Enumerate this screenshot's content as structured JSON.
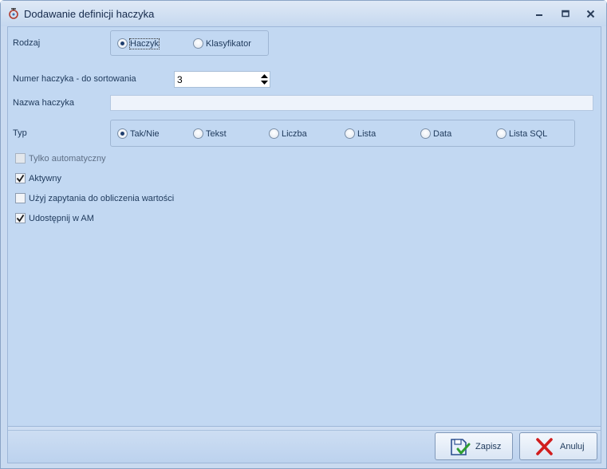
{
  "window": {
    "title": "Dodawanie definicji haczyka",
    "icon": "hook-definition-icon",
    "controls": [
      "minimize-icon",
      "maximize-icon",
      "close-icon"
    ]
  },
  "form": {
    "rodzaj": {
      "label": "Rodzaj",
      "options": [
        {
          "label": "Haczyk",
          "selected": true
        },
        {
          "label": "Klasyfikator",
          "selected": false
        }
      ]
    },
    "numer": {
      "label": "Numer haczyka - do sortowania",
      "value": "3"
    },
    "nazwa": {
      "label": "Nazwa haczyka",
      "value": ""
    },
    "typ": {
      "label": "Typ",
      "options": [
        {
          "label": "Tak/Nie",
          "selected": true
        },
        {
          "label": "Tekst",
          "selected": false
        },
        {
          "label": "Liczba",
          "selected": false
        },
        {
          "label": "Lista",
          "selected": false
        },
        {
          "label": "Data",
          "selected": false
        },
        {
          "label": "Lista SQL",
          "selected": false
        }
      ]
    },
    "checkboxes": [
      {
        "label": "Tylko automatyczny",
        "checked": false,
        "enabled": false
      },
      {
        "label": "Aktywny",
        "checked": true,
        "enabled": true
      },
      {
        "label": "Użyj zapytania do obliczenia wartości",
        "checked": false,
        "enabled": true
      },
      {
        "label": "Udostępnij w AM",
        "checked": true,
        "enabled": true
      }
    ]
  },
  "buttons": {
    "save": {
      "label": "Zapisz",
      "icon": "save-disk-check-icon"
    },
    "cancel": {
      "label": "Anuluj",
      "icon": "red-x-icon"
    }
  },
  "colors": {
    "accent": "#1f3e6e",
    "cancel_icon": "#d11d1d",
    "save_check": "#2f9e2f"
  }
}
